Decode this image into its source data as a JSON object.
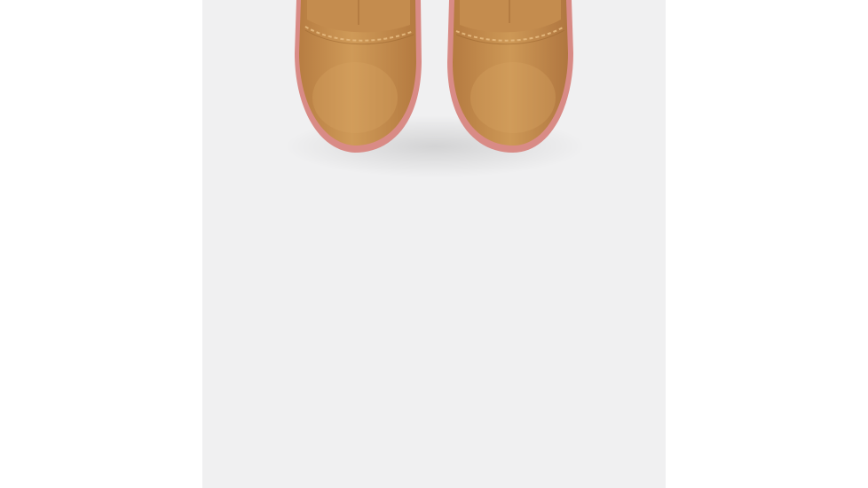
{
  "product_image": {
    "subject": "boots",
    "colors": {
      "panel_background": "#f0f0f1",
      "suede": "#c8914f",
      "suede_shadow": "#a8733a",
      "sole": "#d98b86",
      "stitch": "#e2b57a"
    }
  }
}
